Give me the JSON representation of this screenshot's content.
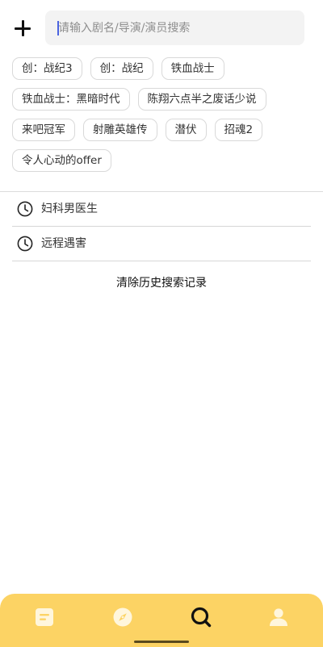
{
  "search": {
    "placeholder": "请输入剧名/导演/演员搜索"
  },
  "hot_tags": [
    "创：战纪3",
    "创：战纪",
    "铁血战士",
    "铁血战士：黑暗时代",
    "陈翔六点半之废话少说",
    "来吧冠军",
    "射雕英雄传",
    "潜伏",
    "招魂2",
    "令人心动的offer"
  ],
  "history": [
    {
      "label": "妇科男医生",
      "icon": "clock-icon"
    },
    {
      "label": "远程遇害",
      "icon": "clock-icon"
    }
  ],
  "clear_history_label": "清除历史搜索记录",
  "bottom_nav": [
    {
      "icon": "document-icon",
      "active": false
    },
    {
      "icon": "compass-icon",
      "active": false
    },
    {
      "icon": "search-icon",
      "active": true
    },
    {
      "icon": "profile-icon",
      "active": false
    }
  ],
  "colors": {
    "nav_background": "#fcd364",
    "nav_icon": "#fff6dc",
    "nav_active_icon": "#111111",
    "caret": "#4a63e0",
    "search_background": "#f3f3f3"
  }
}
